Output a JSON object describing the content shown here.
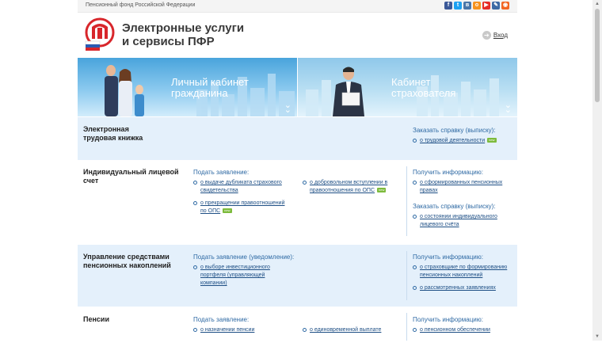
{
  "topbar": {
    "org_name": "Пенсионный фонд Российской Федерации",
    "socials": [
      {
        "icon": "facebook-icon",
        "glyph": "f",
        "color": "#3b5998"
      },
      {
        "icon": "twitter-icon",
        "glyph": "t",
        "color": "#1da1f2"
      },
      {
        "icon": "vk-icon",
        "glyph": "в",
        "color": "#4a76a8"
      },
      {
        "icon": "odnoklassniki-icon",
        "glyph": "o",
        "color": "#f7931e"
      },
      {
        "icon": "youtube-icon",
        "glyph": "▶",
        "color": "#e52d27"
      },
      {
        "icon": "livejournal-icon",
        "glyph": "✎",
        "color": "#3d6aa5"
      },
      {
        "icon": "rss-icon",
        "glyph": "◉",
        "color": "#f26522"
      }
    ]
  },
  "header": {
    "title_line1": "Электронные услуги",
    "title_line2": "и сервисы ПФР",
    "login_label": "Вход"
  },
  "banners": {
    "citizen": {
      "line1": "Личный кабинет",
      "line2": "гражданина"
    },
    "insurer": {
      "line1": "Кабинет",
      "line2": "страхователя"
    }
  },
  "badge_label": "new",
  "sections": {
    "s1": {
      "title1": "Электронная",
      "title2": "трудовая книжка",
      "right_head": "Заказать справку (выписку):",
      "right_link": "о трудовой деятельности"
    },
    "s2": {
      "title1": "Индивидуальный лицевой",
      "title2": "счет",
      "left_head": "Подать заявление:",
      "link_a1": "о выдаче дубликата страхового",
      "link_a2": "свидетельства",
      "link_b1": "о прекращении правоотношений",
      "link_b2": "по ОПС",
      "link_c1": "о добровольном вступлении в",
      "link_c2": "правоотношения по ОПС",
      "right_head": "Получить информацию:",
      "right_link1": "о сформированных пенсионных",
      "right_link2": "правах",
      "right_head2": "Заказать справку (выписку):",
      "right_link3": "о состоянии индивидуального",
      "right_link4": "лицевого счёта"
    },
    "s3": {
      "title1": "Управление средствами",
      "title2": "пенсионных накоплений",
      "left_head": "Подать заявление (уведомление):",
      "link_a1": "о выборе инвестиционного",
      "link_a2": "портфеля (управляющей",
      "link_a3": "компании)",
      "right_head": "Получить информацию:",
      "right_link1": "о страховщике по формированию",
      "right_link2": "пенсионных накоплений",
      "right_link3": "о рассмотренных заявлениях"
    },
    "s4": {
      "title1": "Пенсии",
      "left_head": "Подать заявление:",
      "link_a1": "о назначении пенсии",
      "link_c1": "о единовременной выплате",
      "right_head": "Получить информацию:",
      "right_link1": "о пенсионном обеспечении"
    }
  }
}
